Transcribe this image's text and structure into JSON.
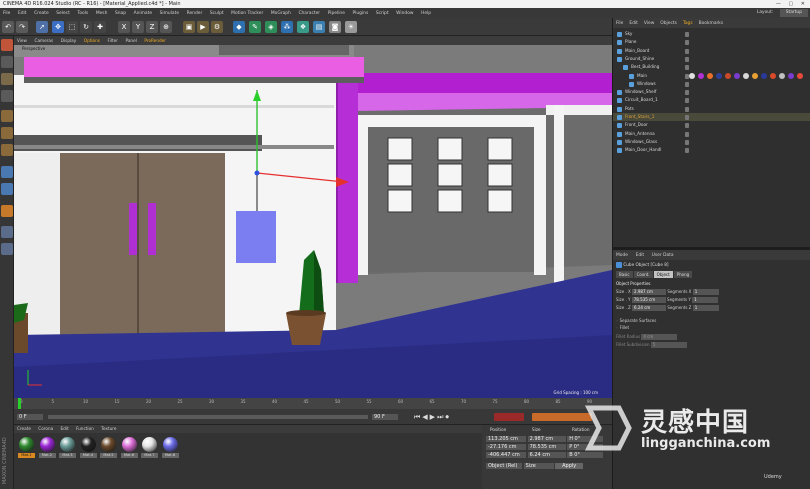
{
  "window": {
    "title": "CINEMA 4D R16.024 Studio (RC - R16) - [Material_Applied.c4d *] - Main",
    "controls": "— ▢ ✕"
  },
  "menubar": [
    "File",
    "Edit",
    "Create",
    "Select",
    "Tools",
    "Mesh",
    "Snap",
    "Animate",
    "Simulate",
    "Render",
    "Sculpt",
    "Motion Tracker",
    "MoGraph",
    "Character",
    "Pipeline",
    "Plugins",
    "Script",
    "Window",
    "Help"
  ],
  "layout": {
    "label": "Layout:",
    "value": "Startup"
  },
  "viewport_menu": [
    {
      "label": "View",
      "active": false
    },
    {
      "label": "Cameras",
      "active": false
    },
    {
      "label": "Display",
      "active": false
    },
    {
      "label": "Options",
      "active": true
    },
    {
      "label": "Filter",
      "active": false
    },
    {
      "label": "Panel",
      "active": false
    },
    {
      "label": "ProRender",
      "active": false
    }
  ],
  "viewport": {
    "name": "Perspective",
    "grid_spacing": "Grid Spacing : 100 cm"
  },
  "timeline": {
    "ticks": [
      "0",
      "5",
      "10",
      "15",
      "20",
      "25",
      "30",
      "35",
      "40",
      "45",
      "50",
      "55",
      "60",
      "65",
      "70",
      "75",
      "80",
      "85",
      "90"
    ],
    "start": "0 F",
    "end": "90 F",
    "current": "0 F"
  },
  "material_menu": [
    "Create",
    "Corona",
    "Edit",
    "Function",
    "Texture"
  ],
  "materials": [
    {
      "name": "Mat.1",
      "color": "#2f8a2f"
    },
    {
      "name": "Mat.2",
      "color": "#9b27d6"
    },
    {
      "name": "Mat.3",
      "color": "#6a9c98"
    },
    {
      "name": "Mat.4",
      "color": "#222222"
    },
    {
      "name": "Mat.5",
      "color": "#6b4a2c"
    },
    {
      "name": "Mat.6",
      "color": "#dd6fd7"
    },
    {
      "name": "Mat.7",
      "color": "#e6e6e6"
    },
    {
      "name": "Mat.8",
      "color": "#6b6be8"
    }
  ],
  "coords": {
    "headers": [
      "Position",
      "Size",
      "Rotation"
    ],
    "rows": [
      [
        "113.205 cm",
        "2.987 cm",
        "H 0°"
      ],
      [
        "-27.176 cm",
        "78.535 cm",
        "P 0°"
      ],
      [
        "-406.447 cm",
        "6.24 cm",
        "B 0°"
      ]
    ],
    "mode": "Object (Rel)",
    "size_mode": "Size",
    "apply": "Apply"
  },
  "object_manager": {
    "menu": [
      {
        "label": "File",
        "active": false
      },
      {
        "label": "Edit",
        "active": false
      },
      {
        "label": "View",
        "active": false
      },
      {
        "label": "Objects",
        "active": false
      },
      {
        "label": "Tags",
        "active": true
      },
      {
        "label": "Bookmarks",
        "active": false
      }
    ],
    "objects": [
      {
        "name": "Sky",
        "indent": 0,
        "color": "#d8d8d8"
      },
      {
        "name": "Plane",
        "indent": 0,
        "color": "#d8d8d8"
      },
      {
        "name": "Main_Board",
        "indent": 0,
        "color": "#d8d8d8"
      },
      {
        "name": "Ground_Shine",
        "indent": 0,
        "color": "#d8d8d8"
      },
      {
        "name": "Best_Building",
        "indent": 1,
        "color": "#d8d8d8"
      },
      {
        "name": "Main",
        "indent": 2,
        "color": "#d8d8d8"
      },
      {
        "name": "Windows",
        "indent": 2,
        "color": "#d8d8d8"
      },
      {
        "name": "Windows_Shelf",
        "indent": 0,
        "color": "#d8d8d8"
      },
      {
        "name": "Circuit_Board_1",
        "indent": 0,
        "color": "#d8d8d8"
      },
      {
        "name": "Pots",
        "indent": 0,
        "color": "#d8d8d8"
      },
      {
        "name": "Front_Stairs_1",
        "indent": 0,
        "color": "#e0a23a"
      },
      {
        "name": "Front_Door",
        "indent": 0,
        "color": "#d8d8d8"
      },
      {
        "name": "Main_Antenna",
        "indent": 0,
        "color": "#d8d8d8"
      },
      {
        "name": "Windows_Glass",
        "indent": 0,
        "color": "#d8d8d8"
      },
      {
        "name": "Main_Door_Handl",
        "indent": 0,
        "color": "#d8d8d8"
      }
    ]
  },
  "attribute_manager": {
    "menu": [
      "Mode",
      "Edit",
      "User Data"
    ],
    "title": "Cube Object [Cube 8]",
    "tabs": [
      {
        "label": "Basic",
        "active": false
      },
      {
        "label": "Coord.",
        "active": false
      },
      {
        "label": "Object",
        "active": true
      },
      {
        "label": "Phong",
        "active": false
      }
    ],
    "section": "Object Properties",
    "props": [
      {
        "label": "Size . X",
        "value": "2.987 cm",
        "seg": "Segments X",
        "segv": "1"
      },
      {
        "label": "Size . Y",
        "value": "78.535 cm",
        "seg": "Segments Y",
        "segv": "1"
      },
      {
        "label": "Size . Z",
        "value": "6.24 cm",
        "seg": "Segments Z",
        "segv": "1"
      }
    ],
    "separate": "Separate Surfaces",
    "fillet": "Fillet",
    "fillet_radius": "Fillet Radius",
    "fillet_radius_val": "4 cm",
    "fillet_sub": "Fillet Subdivision",
    "fillet_sub_val": "5"
  },
  "watermark": {
    "cn": "灵感中国",
    "url": "lingganchina.com",
    "udemy": "Udemy"
  },
  "maxon": "MAXON CINEMA4D"
}
